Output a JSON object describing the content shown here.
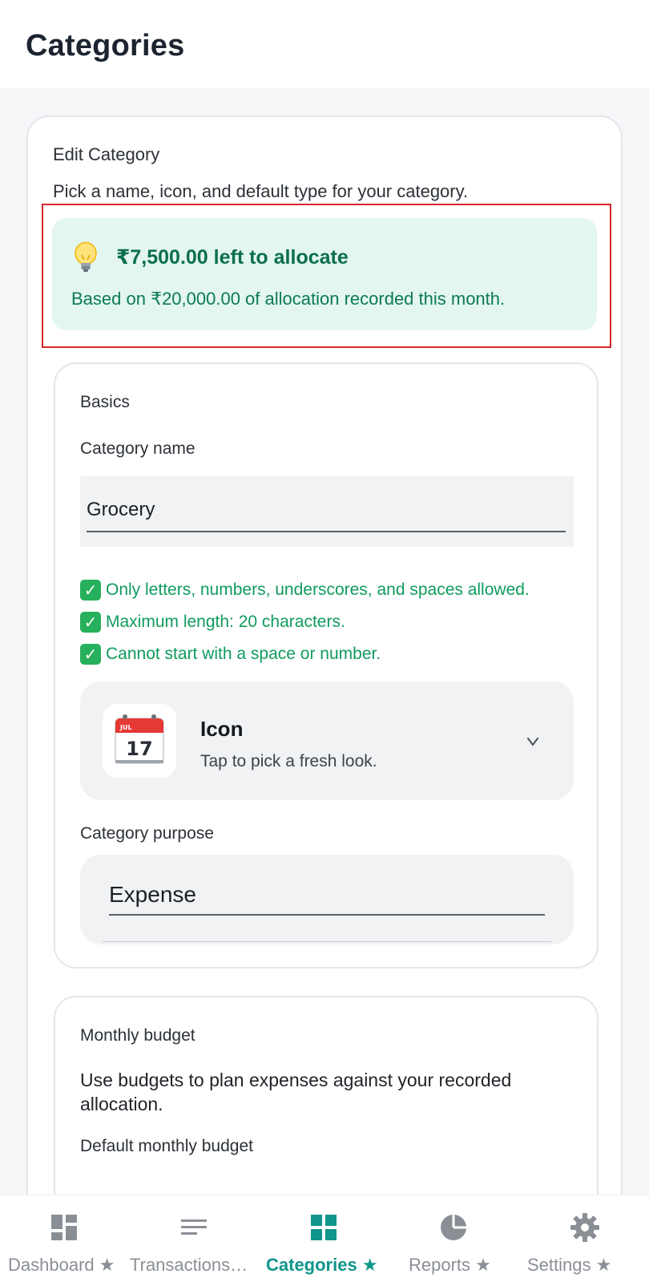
{
  "header": {
    "title": "Categories"
  },
  "edit": {
    "title": "Edit Category",
    "subtitle": "Pick a name, icon, and default type for your category."
  },
  "allocation": {
    "title": "₹7,500.00 left to allocate",
    "description": "Based on ₹20,000.00 of allocation recorded this month.",
    "icon": "lightbulb-icon"
  },
  "basics": {
    "heading": "Basics",
    "name_label": "Category name",
    "name_value": "Grocery",
    "rules": [
      "Only letters, numbers, underscores, and spaces allowed.",
      "Maximum length: 20 characters.",
      "Cannot start with a space or number."
    ],
    "icon_picker": {
      "title": "Icon",
      "subtitle": "Tap to pick a fresh look.",
      "calendar_month": "JUL",
      "calendar_day": "17"
    },
    "purpose_label": "Category purpose",
    "purpose_value": "Expense"
  },
  "budget": {
    "heading": "Monthly budget",
    "description": "Use budgets to plan expenses against your recorded allocation.",
    "default_label": "Default monthly budget"
  },
  "nav": {
    "items": [
      {
        "label": "Dashboard ★",
        "icon": "dashboard-icon",
        "active": false
      },
      {
        "label": "Transactions…",
        "icon": "transactions-icon",
        "active": false
      },
      {
        "label": "Categories ★",
        "icon": "categories-icon",
        "active": true
      },
      {
        "label": "Reports ★",
        "icon": "reports-icon",
        "active": false
      },
      {
        "label": "Settings ★",
        "icon": "settings-icon",
        "active": false
      }
    ]
  },
  "colors": {
    "accent": "#10958a",
    "success": "#0f9b5d",
    "highlight": "#d8262b",
    "alloc_bg": "#e3f6f1"
  }
}
